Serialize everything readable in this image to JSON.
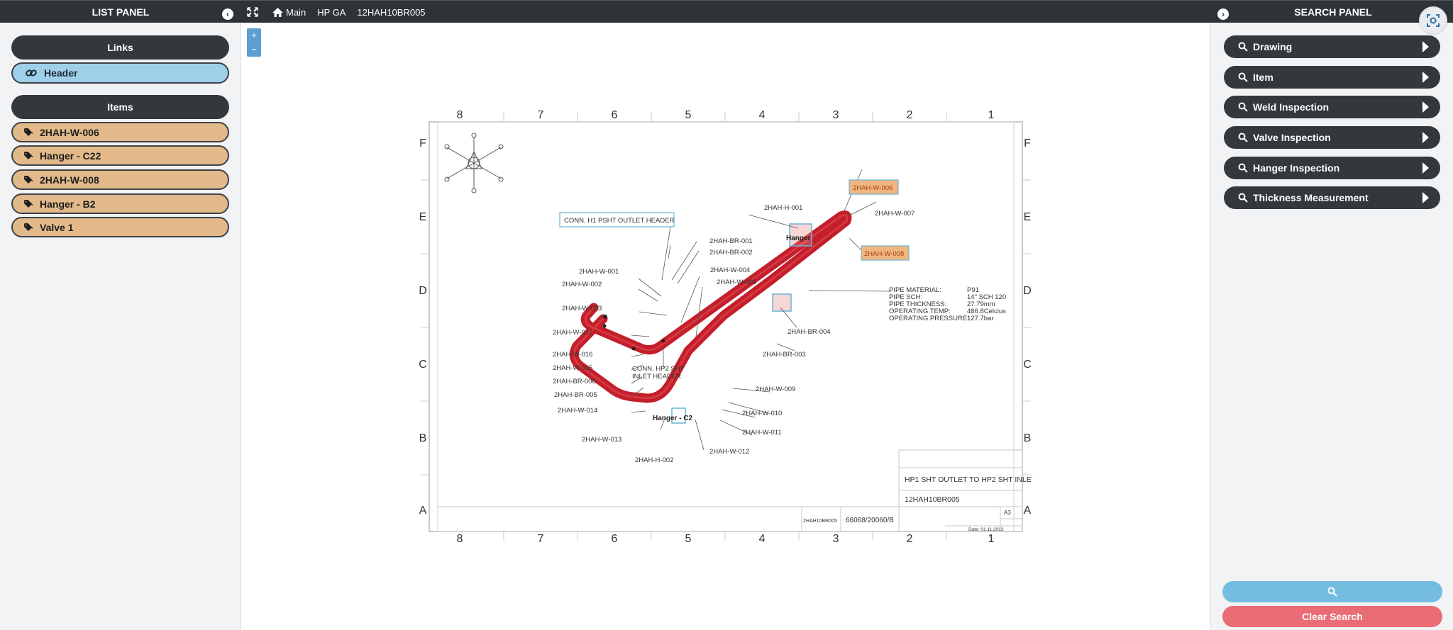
{
  "list_panel": {
    "title": "LIST PANEL",
    "links_header": "Links",
    "links": [
      {
        "label": "Header"
      }
    ],
    "items_header": "Items",
    "items": [
      {
        "label": "2HAH-W-006"
      },
      {
        "label": "Hanger - C22"
      },
      {
        "label": "2HAH-W-008"
      },
      {
        "label": "Hanger - B2"
      },
      {
        "label": "Valve 1"
      }
    ]
  },
  "breadcrumb": [
    "Main",
    "HP GA",
    "12HAH10BR005"
  ],
  "search_panel": {
    "title": "SEARCH PANEL",
    "items": [
      {
        "label": "Drawing"
      },
      {
        "label": "Item"
      },
      {
        "label": "Weld Inspection"
      },
      {
        "label": "Valve Inspection"
      },
      {
        "label": "Hanger Inspection"
      },
      {
        "label": "Thickness Measurement"
      }
    ],
    "clear_label": "Clear Search"
  },
  "zoom": {
    "in": "+",
    "out": "−"
  },
  "drawing": {
    "col_numbers": [
      "8",
      "7",
      "6",
      "5",
      "4",
      "3",
      "2",
      "1"
    ],
    "row_letters": [
      "F",
      "E",
      "D",
      "C",
      "B",
      "A"
    ],
    "labels": {
      "conn_h1": "CONN. H1 PSHT  OUTLET HEADER",
      "conn_hp2_1": "CONN. HP2 SHT",
      "conn_hp2_2": "INLET HEADER",
      "h001": "2HAH-H-001",
      "h002": "2HAH-H-002",
      "w006": "2HAH-W-006",
      "w007": "2HAH-W-007",
      "w008": "2HAH-W-008",
      "hanger": "Hanger",
      "hanger_c2": "Hanger - C2",
      "br001": "2HAH-BR-001",
      "br002": "2HAH-BR-002",
      "br003": "2HAH-BR-003",
      "br004": "2HAH-BR-004",
      "br005": "2HAH-BR-005",
      "br006": "2HAH-BR-006",
      "w001": "2HAH-W-001",
      "w002": "2HAH-W-002",
      "w003": "2HAH-W-003",
      "w004": "2HAH-W-004",
      "w005": "2HAH-W-005",
      "w009": "2HAH-W-009",
      "w010": "2HAH-W-010",
      "w011": "2HAH-W-011",
      "w012": "2HAH-W-012",
      "w013": "2HAH-W-013",
      "w014": "2HAH-W-014",
      "w015": "2HAH-W-015",
      "w016": "2HAH-W-016",
      "w017": "2HAH-W-017"
    },
    "specs": [
      {
        "key": "PIPE MATERIAL:",
        "value": "P91"
      },
      {
        "key": "PIPE SCH:",
        "value": "14\" SCH 120"
      },
      {
        "key": "PIPE THICKNESS:",
        "value": "27.79mm"
      },
      {
        "key": "OPERATING TEMP:",
        "value": "486.8Celcius"
      },
      {
        "key": "OPERATING PRESSURE:",
        "value": "127.7bar"
      }
    ],
    "title_block": {
      "title": "HP1 SHT OUTLET TO HP2 SHT INLET",
      "drawing_no": "12HAH10BR005",
      "size": "A3",
      "ref1": "2HAH10BR005",
      "ref2": "66068/20060/B",
      "date": "Date: 01.11.2013"
    }
  },
  "colors": {
    "pipe": "#c41e2a",
    "header_dark": "#33383d",
    "link_blue": "#9fd0ea",
    "item_tan": "#e3b98a",
    "search_blue": "#75bde0",
    "clear_red": "#ea6c74",
    "highlight": "#f1b67d"
  },
  "icons": {
    "collapse": "chevron-left-icon",
    "expand": "chevron-right-icon",
    "home": "home-icon",
    "fit": "fit-screen-icon",
    "link": "link-icon",
    "tag": "tag-icon",
    "search": "magnifier-icon",
    "screenshot": "screenshot-icon"
  }
}
